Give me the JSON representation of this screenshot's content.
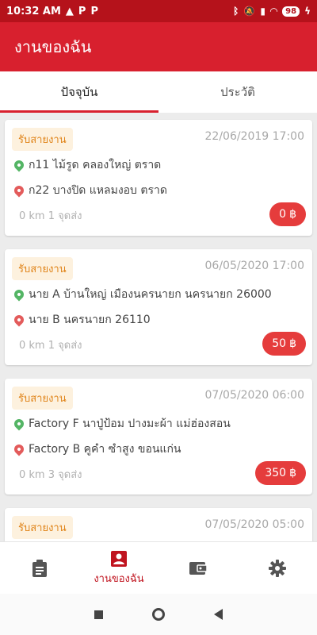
{
  "status_bar": {
    "time": "10:32 AM",
    "battery": "98"
  },
  "app_bar": {
    "title": "งานของฉัน"
  },
  "tabs": [
    {
      "label": "ปัจจุบัน",
      "active": true
    },
    {
      "label": "ประวัติ",
      "active": false
    }
  ],
  "jobs": [
    {
      "status": "รับสายงาน",
      "datetime": "22/06/2019 17:00",
      "pickup": "ก11 ไม้รูด คลองใหญ่ ตราด",
      "dropoff": "ก22 บางปิด แหลมงอบ ตราด",
      "meta": "0 km 1 จุดส่ง",
      "price": "0",
      "currency": "฿"
    },
    {
      "status": "รับสายงาน",
      "datetime": "06/05/2020 17:00",
      "pickup": "นาย A บ้านใหญ่ เมืองนครนายก นครนายก 26000",
      "dropoff": "นาย B นครนายก 26110",
      "meta": "0 km 1 จุดส่ง",
      "price": "50",
      "currency": "฿"
    },
    {
      "status": "รับสายงาน",
      "datetime": "07/05/2020 06:00",
      "pickup": "Factory F นาปู่ป้อม ปางมะผ้า แม่ฮ่องสอน",
      "dropoff": "Factory B คูคำ ซำสูง ขอนแก่น",
      "meta": "0 km 3 จุดส่ง",
      "price": "350",
      "currency": "฿"
    },
    {
      "status": "รับสายงาน",
      "datetime": "07/05/2020 05:00"
    }
  ],
  "bottom_nav": [
    {
      "icon": "clipboard-icon",
      "label": ""
    },
    {
      "icon": "account-box-icon",
      "label": "งานของฉัน"
    },
    {
      "icon": "wallet-icon",
      "label": ""
    },
    {
      "icon": "gear-icon",
      "label": ""
    }
  ],
  "colors": {
    "primary": "#d8202e",
    "status_bar": "#b5121b",
    "badge_text": "#e0851b",
    "price_bg": "#e53c3c",
    "pickup_pin": "#54b565",
    "dropoff_pin": "#e35b5b"
  }
}
